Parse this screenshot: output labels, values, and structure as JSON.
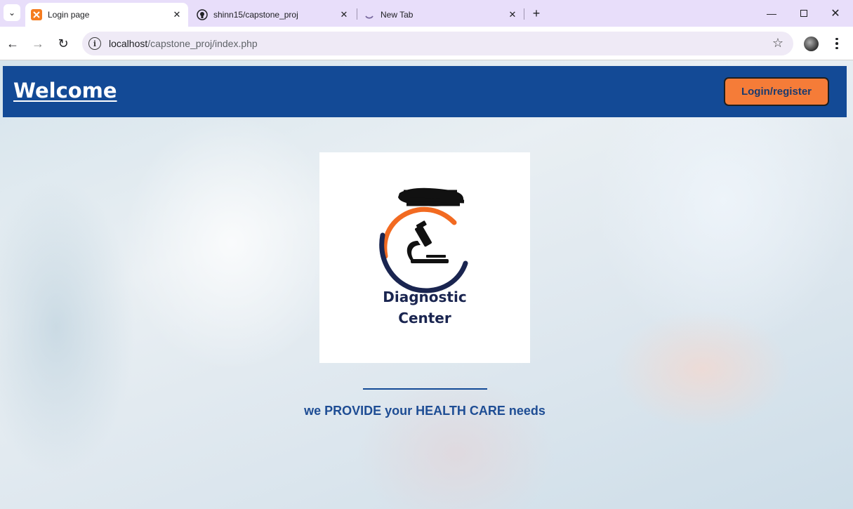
{
  "browser": {
    "tabs": [
      {
        "title": "Login page",
        "icon": "xampp-icon",
        "active": true
      },
      {
        "title": "shinn15/capstone_proj",
        "icon": "github-icon",
        "active": false
      },
      {
        "title": "New Tab",
        "icon": "loading-spinner-icon",
        "active": false
      }
    ],
    "url_host": "localhost",
    "url_path": "/capstone_proj/index.php"
  },
  "page": {
    "header_title": "Welcome",
    "login_button_label": "Login/register",
    "logo_line1": "Diagnostic",
    "logo_line2": "Center",
    "tagline": "we PROVIDE your HEALTH CARE needs"
  },
  "colors": {
    "header_bg": "#134a96",
    "button_bg": "#f57c38",
    "tagline": "#1e4d94",
    "logo_orange": "#f26a21",
    "logo_navy": "#1a2550"
  }
}
